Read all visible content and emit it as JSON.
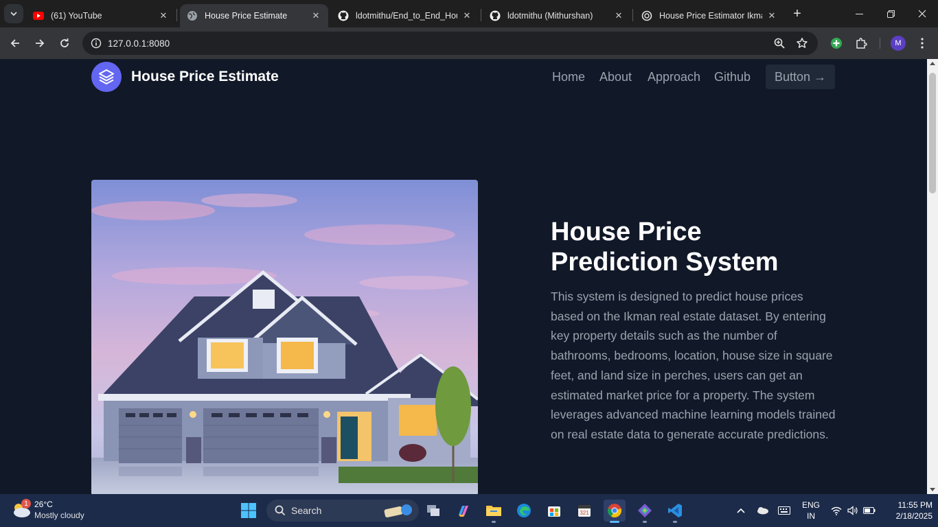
{
  "browser": {
    "tabs": [
      {
        "title": "(61) YouTube",
        "active": false
      },
      {
        "title": "House Price Estimate",
        "active": true
      },
      {
        "title": "ldotmithu/End_to_End_Hous",
        "active": false
      },
      {
        "title": "ldotmithu (Mithurshan)",
        "active": false
      },
      {
        "title": "House Price Estimator Ikman",
        "active": false
      }
    ],
    "url": "127.0.0.1:8080",
    "profile_initial": "M"
  },
  "site": {
    "name": "House Price Estimate",
    "nav": [
      "Home",
      "About",
      "Approach",
      "Github"
    ],
    "nav_button": "Button →"
  },
  "hero": {
    "title_line1": "House Price",
    "title_line2": "Prediction System",
    "text_lines": [
      "This system is designed to predict house prices",
      "based on the Ikman real estate dataset. By entering",
      "key property details such as the number of",
      "bathrooms, bedrooms, location, house size in square",
      "feet, and land size in perches, users can get an",
      "estimated market price for a property. The system",
      "leverages advanced machine learning models trained",
      "on real estate data to generate accurate predictions."
    ]
  },
  "taskbar": {
    "weather_badge": "1",
    "temperature": "26°C",
    "weather": "Mostly cloudy",
    "search_label": "Search",
    "lang_line1": "ENG",
    "lang_line2": "IN",
    "time": "11:55 PM",
    "date": "2/18/2025"
  },
  "colors": {
    "page_bg": "#111827",
    "accent": "#6366f1",
    "nav_text": "#9ca3af"
  }
}
